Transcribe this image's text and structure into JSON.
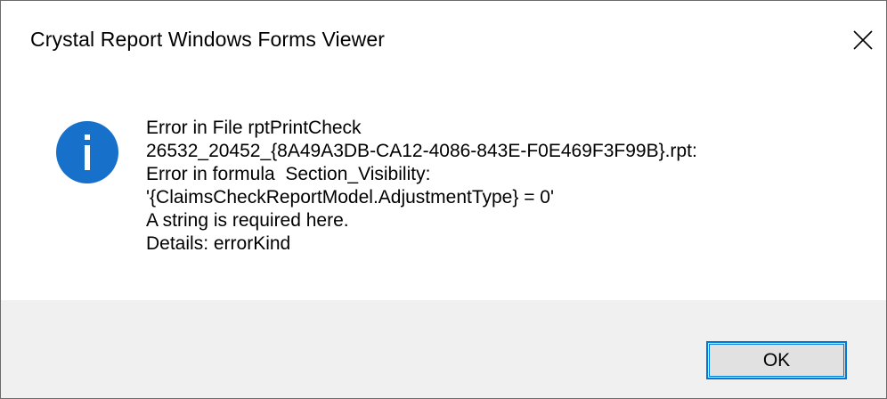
{
  "window": {
    "title": "Crystal Report Windows Forms Viewer",
    "close_icon": "close-icon"
  },
  "message": {
    "icon": "info-icon",
    "lines": [
      "Error in File rptPrintCheck",
      "26532_20452_{8A49A3DB-CA12-4086-843E-F0E469F3F99B}.rpt:",
      "Error in formula  Section_Visibility:",
      "'{ClaimsCheckReportModel.AdjustmentType} = 0'",
      "A string is required here.",
      "Details: errorKind"
    ]
  },
  "buttons": {
    "ok_label": "OK"
  },
  "colors": {
    "info_icon_bg": "#1770c9",
    "button_border": "#0078d7",
    "footer_bg": "#f0f0f0"
  }
}
